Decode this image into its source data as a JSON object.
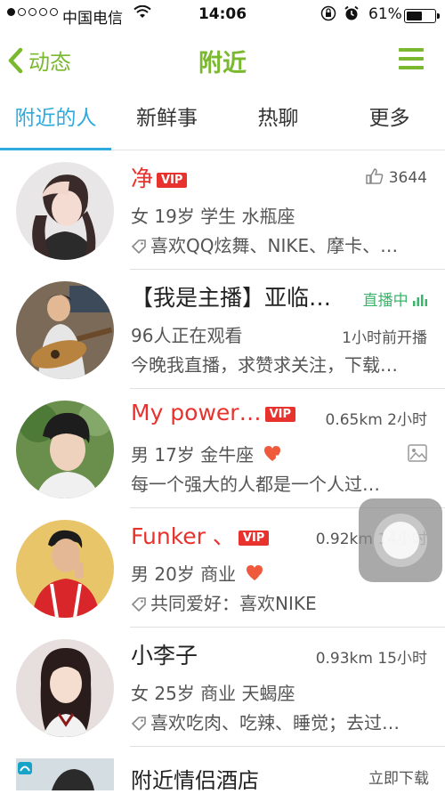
{
  "status": {
    "carrier": "中国电信",
    "time": "14:06",
    "battery": "61%",
    "battery_level": 0.61
  },
  "nav": {
    "back_label": "动态",
    "title": "附近"
  },
  "tabs": [
    {
      "label": "附近的人",
      "active": true
    },
    {
      "label": "新鲜事",
      "active": false
    },
    {
      "label": "热聊",
      "active": false
    },
    {
      "label": "更多",
      "active": false
    }
  ],
  "people": [
    {
      "name": "净",
      "vip": "VIP",
      "likes": "3644",
      "info": "女 19岁  学生  水瓶座",
      "tags": "喜欢QQ炫舞、NIKE、摩卡、…"
    },
    {
      "name": "【我是主播】亚临…",
      "live_status": "直播中",
      "viewers": "96人正在观看",
      "started": "1小时前开播",
      "desc": "今晚我直播，求赞求关注，下载…"
    },
    {
      "name": "My    power…",
      "vip": "VIP",
      "distance": "0.65km 2小时",
      "info": "男 17岁  金牛座",
      "heart_level": "5",
      "desc": "每一个强大的人都是一个人过…"
    },
    {
      "name": "Funker    、",
      "vip": "VIP",
      "distance": "0.92km 14小时",
      "info": "男 20岁  商业",
      "heart_level": "4",
      "tags": "共同爱好：喜欢NIKE"
    },
    {
      "name": "小李子",
      "distance": "0.93km 15小时",
      "info": "女 25岁  商业  天蝎座",
      "tags": "喜欢吃肉、吃辣、睡觉；去过…"
    }
  ],
  "ad": {
    "title": "附近情侣酒店",
    "action": "立即下载"
  },
  "colors": {
    "accent_green": "#7ab92f",
    "accent_blue": "#2eaadc",
    "vip_red": "#e8322e",
    "live_green": "#3bb56b"
  }
}
